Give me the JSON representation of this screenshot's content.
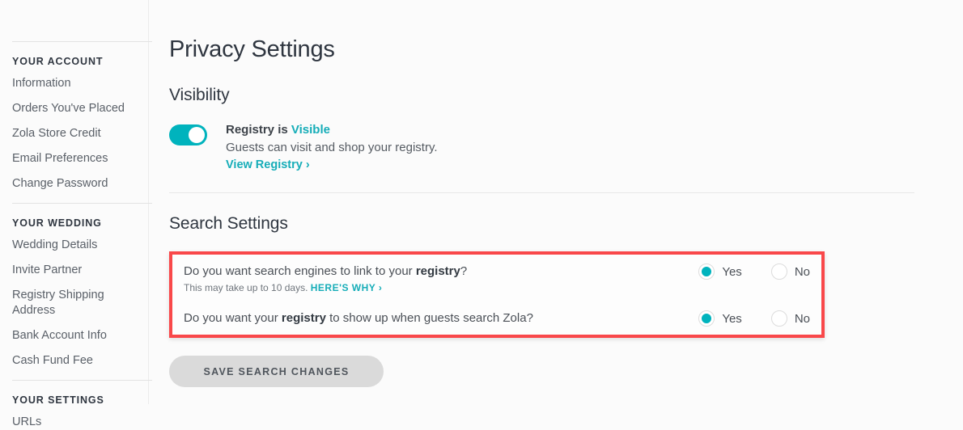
{
  "sidebar": {
    "groups": [
      {
        "title": "YOUR ACCOUNT",
        "items": [
          "Information",
          "Orders You've Placed",
          "Zola Store Credit",
          "Email Preferences",
          "Change Password"
        ]
      },
      {
        "title": "YOUR WEDDING",
        "items": [
          "Wedding Details",
          "Invite Partner",
          "Registry Shipping Address",
          "Bank Account Info",
          "Cash Fund Fee"
        ]
      },
      {
        "title": "YOUR SETTINGS",
        "items": [
          "URLs"
        ]
      }
    ]
  },
  "main": {
    "page_title": "Privacy Settings",
    "visibility": {
      "section_title": "Visibility",
      "toggle_state": "on",
      "status_prefix": "Registry is ",
      "status_value": "Visible",
      "description": "Guests can visit and shop your registry.",
      "link": "View Registry ›"
    },
    "search": {
      "section_title": "Search Settings",
      "questions": [
        {
          "prefix": "Do you want search engines to link to your ",
          "bold": "registry",
          "suffix": "?",
          "subtext": "This may take up to 10 days.",
          "sublink": "HERE'S WHY ›",
          "selected": "Yes",
          "options": [
            "Yes",
            "No"
          ]
        },
        {
          "prefix": "Do you want your ",
          "bold": "registry",
          "suffix": " to show up when guests search Zola?",
          "subtext": "",
          "sublink": "",
          "selected": "Yes",
          "options": [
            "Yes",
            "No"
          ]
        }
      ],
      "save_label": "SAVE SEARCH CHANGES"
    }
  },
  "colors": {
    "accent_teal": "#00b3bd",
    "link_teal": "#16adb8",
    "highlight_red": "#f9484a",
    "button_gray": "#dadada"
  }
}
